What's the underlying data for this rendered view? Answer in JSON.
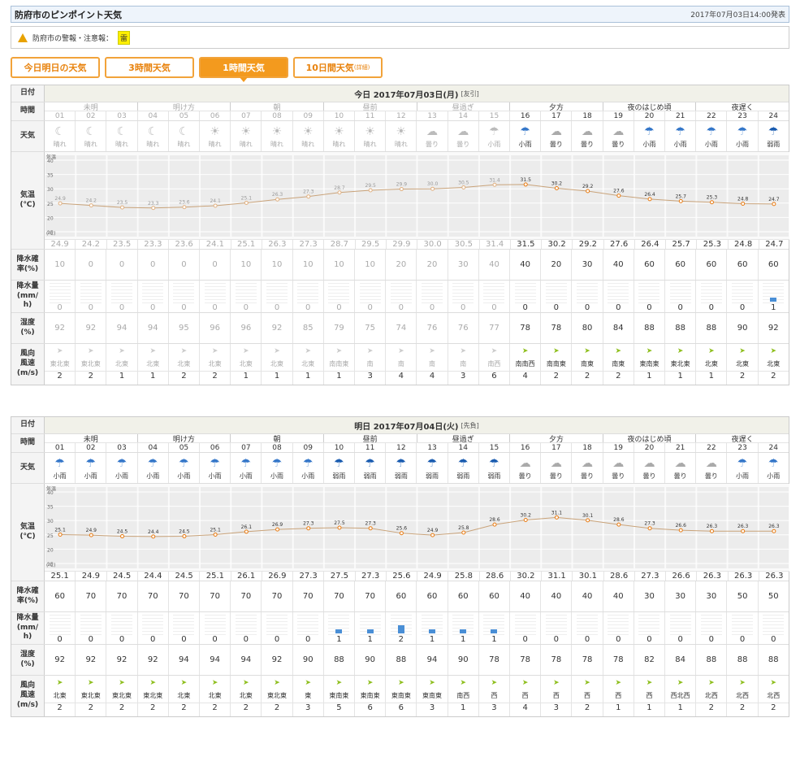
{
  "header": {
    "title": "防府市のピンポイント天気",
    "issued": "2017年07月03日14:00発表"
  },
  "alert": {
    "label": "防府市の警報・注意報：",
    "badge": "雷"
  },
  "tabs": [
    {
      "label": "今日明日の天気"
    },
    {
      "label": "3時間天気"
    },
    {
      "label": "1時間天気",
      "active": true
    },
    {
      "label": "10日間天気",
      "sub": "(詳細)"
    }
  ],
  "labels": {
    "date": "日付",
    "time": "時間",
    "weather": "天気",
    "temp": "気温\n(℃)",
    "pop": "降水確\n率(%)",
    "precip": "降水量\n(mm/\nh)",
    "humidity": "湿度\n(%)",
    "wind": "風向\n風速\n(m/s)"
  },
  "chart_axis": {
    "unit_top": "気温",
    "unit_bottom": "(℃)",
    "ticks": [
      40,
      35,
      30,
      25,
      20,
      15
    ]
  },
  "periods": [
    "未明",
    "明け方",
    "朝",
    "昼前",
    "昼過ぎ",
    "夕方",
    "夜のはじめ頃",
    "夜遅く"
  ],
  "hours": [
    "01",
    "02",
    "03",
    "04",
    "05",
    "06",
    "07",
    "08",
    "09",
    "10",
    "11",
    "12",
    "13",
    "14",
    "15",
    "16",
    "17",
    "18",
    "19",
    "20",
    "21",
    "22",
    "23",
    "24"
  ],
  "days": [
    {
      "title": "今日 2017年07月03日(月)",
      "rokuyo": "[友引]",
      "past_until": 15,
      "weather": [
        "晴れ",
        "晴れ",
        "晴れ",
        "晴れ",
        "晴れ",
        "晴れ",
        "晴れ",
        "晴れ",
        "晴れ",
        "晴れ",
        "晴れ",
        "晴れ",
        "曇り",
        "曇り",
        "小雨",
        "小雨",
        "曇り",
        "曇り",
        "曇り",
        "小雨",
        "小雨",
        "小雨",
        "小雨",
        "弱雨"
      ],
      "icons": [
        "moon",
        "moon",
        "moon",
        "moon",
        "moon",
        "sun",
        "sun",
        "sun",
        "sun",
        "sun",
        "sun",
        "sun",
        "cloud",
        "cloud",
        "umbrella",
        "umbrella",
        "cloud",
        "cloud",
        "cloud",
        "umbrella",
        "umbrella",
        "umbrella",
        "umbrella",
        "heavy-umbrella"
      ],
      "temp": [
        "24.9",
        "24.2",
        "23.5",
        "23.3",
        "23.6",
        "24.1",
        "25.1",
        "26.3",
        "27.3",
        "28.7",
        "29.5",
        "29.9",
        "30.0",
        "30.5",
        "31.4",
        "31.5",
        "30.2",
        "29.2",
        "27.6",
        "26.4",
        "25.7",
        "25.3",
        "24.8",
        "24.7"
      ],
      "pop": [
        "10",
        "0",
        "0",
        "0",
        "0",
        "0",
        "10",
        "10",
        "10",
        "10",
        "10",
        "20",
        "20",
        "30",
        "40",
        "40",
        "20",
        "30",
        "40",
        "60",
        "60",
        "60",
        "60",
        "60"
      ],
      "precip": [
        "0",
        "0",
        "0",
        "0",
        "0",
        "0",
        "0",
        "0",
        "0",
        "0",
        "0",
        "0",
        "0",
        "0",
        "0",
        "0",
        "0",
        "0",
        "0",
        "0",
        "0",
        "0",
        "0",
        "1"
      ],
      "humidity": [
        "92",
        "92",
        "94",
        "94",
        "95",
        "96",
        "96",
        "92",
        "85",
        "79",
        "75",
        "74",
        "76",
        "76",
        "77",
        "78",
        "78",
        "80",
        "84",
        "88",
        "88",
        "88",
        "90",
        "92"
      ],
      "wind_dir": [
        "東北東",
        "東北東",
        "北東",
        "北東",
        "北東",
        "北東",
        "北東",
        "北東",
        "北東",
        "南南東",
        "南",
        "南",
        "南",
        "南",
        "南西",
        "南南西",
        "南南東",
        "南東",
        "南東",
        "東南東",
        "東北東",
        "北東",
        "北東",
        "北東"
      ],
      "wind_speed": [
        "2",
        "2",
        "1",
        "1",
        "2",
        "2",
        "1",
        "1",
        "1",
        "1",
        "3",
        "4",
        "4",
        "3",
        "6",
        "4",
        "2",
        "2",
        "2",
        "1",
        "1",
        "1",
        "2",
        "2"
      ]
    },
    {
      "title": "明日 2017年07月04日(火)",
      "rokuyo": "[先負]",
      "past_until": 0,
      "weather": [
        "小雨",
        "小雨",
        "小雨",
        "小雨",
        "小雨",
        "小雨",
        "小雨",
        "小雨",
        "小雨",
        "弱雨",
        "弱雨",
        "弱雨",
        "弱雨",
        "弱雨",
        "弱雨",
        "曇り",
        "曇り",
        "曇り",
        "曇り",
        "曇り",
        "曇り",
        "曇り",
        "小雨",
        "小雨"
      ],
      "icons": [
        "umbrella",
        "umbrella",
        "umbrella",
        "umbrella",
        "umbrella",
        "umbrella",
        "umbrella",
        "umbrella",
        "umbrella",
        "heavy-umbrella",
        "heavy-umbrella",
        "heavy-umbrella",
        "heavy-umbrella",
        "heavy-umbrella",
        "heavy-umbrella",
        "cloud",
        "cloud",
        "cloud",
        "cloud",
        "cloud",
        "cloud",
        "cloud",
        "umbrella",
        "umbrella"
      ],
      "temp": [
        "25.1",
        "24.9",
        "24.5",
        "24.4",
        "24.5",
        "25.1",
        "26.1",
        "26.9",
        "27.3",
        "27.5",
        "27.3",
        "25.6",
        "24.9",
        "25.8",
        "28.6",
        "30.2",
        "31.1",
        "30.1",
        "28.6",
        "27.3",
        "26.6",
        "26.3",
        "26.3",
        "26.3"
      ],
      "pop": [
        "60",
        "70",
        "70",
        "70",
        "70",
        "70",
        "70",
        "70",
        "70",
        "70",
        "70",
        "60",
        "60",
        "60",
        "60",
        "40",
        "40",
        "40",
        "40",
        "30",
        "30",
        "30",
        "50",
        "50"
      ],
      "precip": [
        "0",
        "0",
        "0",
        "0",
        "0",
        "0",
        "0",
        "0",
        "0",
        "1",
        "1",
        "2",
        "1",
        "1",
        "1",
        "0",
        "0",
        "0",
        "0",
        "0",
        "0",
        "0",
        "0",
        "0"
      ],
      "humidity": [
        "92",
        "92",
        "92",
        "92",
        "94",
        "94",
        "94",
        "92",
        "90",
        "88",
        "90",
        "88",
        "94",
        "90",
        "78",
        "78",
        "78",
        "78",
        "78",
        "82",
        "84",
        "88",
        "88",
        "88"
      ],
      "wind_dir": [
        "北東",
        "東北東",
        "東北東",
        "東北東",
        "北東",
        "北東",
        "北東",
        "東北東",
        "東",
        "東南東",
        "東南東",
        "東南東",
        "東南東",
        "南西",
        "西",
        "西",
        "西",
        "西",
        "西",
        "西",
        "西北西",
        "北西",
        "北西",
        "北西"
      ],
      "wind_speed": [
        "2",
        "2",
        "2",
        "2",
        "2",
        "2",
        "2",
        "2",
        "3",
        "5",
        "6",
        "6",
        "3",
        "1",
        "3",
        "4",
        "3",
        "2",
        "1",
        "1",
        "1",
        "2",
        "2",
        "2"
      ]
    }
  ]
}
